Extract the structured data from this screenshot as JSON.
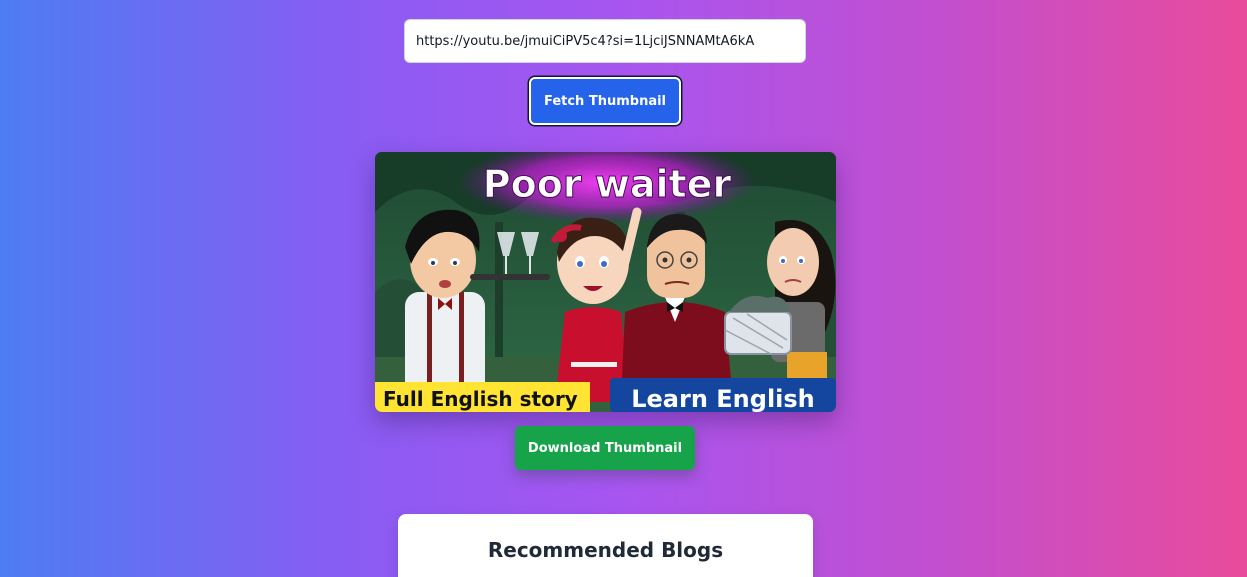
{
  "url_input": {
    "value": "https://youtu.be/jmuiCiPV5c4?si=1LjciJSNNAMtA6kA"
  },
  "fetch_button": {
    "label": "Fetch Thumbnail"
  },
  "thumbnail": {
    "title_text": "Poor waiter",
    "left_banner": "Full English story",
    "right_banner": "Learn English"
  },
  "download_button": {
    "label": "Download Thumbnail"
  },
  "blogs": {
    "title": "Recommended Blogs"
  },
  "colors": {
    "fetch_button": "#2563eb",
    "download_button": "#16a34a",
    "gradient_left": "#4d7cf3",
    "gradient_right": "#e84b9b"
  }
}
